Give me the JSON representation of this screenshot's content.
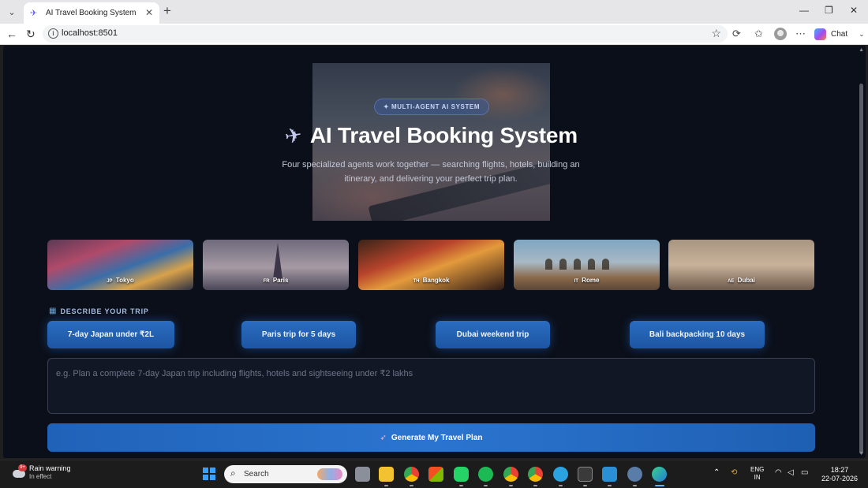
{
  "browser": {
    "tab_title": "AI Travel Booking System",
    "url": "localhost:8501",
    "chat_label": "Chat"
  },
  "hero": {
    "badge": "✦ MULTI-AGENT AI SYSTEM",
    "title": "AI Travel Booking System",
    "subtitle": "Four specialized agents work together — searching flights, hotels, building an itinerary, and delivering your perfect trip plan."
  },
  "destinations": [
    {
      "flag": "JP",
      "name": "Tokyo"
    },
    {
      "flag": "FR",
      "name": "Paris"
    },
    {
      "flag": "TH",
      "name": "Bangkok"
    },
    {
      "flag": "IT",
      "name": "Rome"
    },
    {
      "flag": "AE",
      "name": "Dubai"
    }
  ],
  "describe": {
    "label": "DESCRIBE YOUR TRIP",
    "chips": [
      "7-day Japan under ₹2L",
      "Paris trip for 5 days",
      "Dubai weekend trip",
      "Bali backpacking 10 days"
    ],
    "placeholder": "e.g. Plan a complete 7-day Japan trip including flights, hotels and sightseeing under ₹2 lakhs",
    "generate_label": "Generate My Travel Plan"
  },
  "taskbar": {
    "weather_title": "Rain warning",
    "weather_sub": "In effect",
    "weather_badge": "9+",
    "search_label": "Search",
    "lang_line1": "ENG",
    "lang_line2": "IN",
    "time": "18:27",
    "date": "22-07-2026"
  },
  "colors": {
    "page_bg": "#0b0f19",
    "accent": "#2a6cc0",
    "text": "#ffffff"
  }
}
